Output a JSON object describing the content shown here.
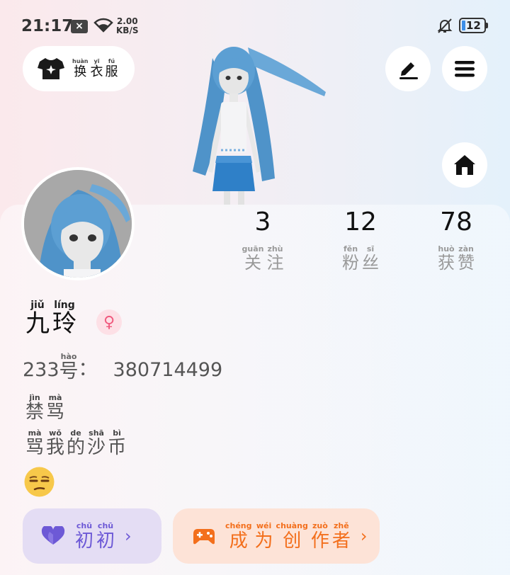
{
  "status_bar": {
    "time": "21:17",
    "close_icon": "x-box-icon",
    "net_speed_value": "2.00",
    "net_speed_unit": "KB/S",
    "battery": "12",
    "colors": {
      "battery_fill": "#3b8ee8"
    }
  },
  "toolbar": {
    "dress_up": {
      "icon": "shirt-icon",
      "chars": [
        {
          "py": "huàn",
          "hz": "换"
        },
        {
          "py": "yī",
          "hz": "衣"
        },
        {
          "py": "fú",
          "hz": "服"
        }
      ]
    },
    "edit_icon": "pencil-icon",
    "menu_icon": "hamburger-icon",
    "home_icon": "home-icon"
  },
  "profile": {
    "name": [
      {
        "py": "jiǔ",
        "hz": "九"
      },
      {
        "py": "líng",
        "hz": "玲"
      }
    ],
    "gender_icon": "♀",
    "uid_prefix": "233",
    "uid_char": {
      "py": "hào",
      "hz": "号"
    },
    "uid_sep": "：",
    "uid_value": "380714499",
    "bio_line1": [
      {
        "py": "jìn",
        "hz": "禁"
      },
      {
        "py": "mà",
        "hz": "骂"
      }
    ],
    "bio_line2": [
      {
        "py": "mà",
        "hz": "骂"
      },
      {
        "py": "wǒ",
        "hz": "我"
      },
      {
        "py": "de",
        "hz": "的"
      },
      {
        "py": "shā",
        "hz": "沙"
      },
      {
        "py": "bì",
        "hz": "币"
      }
    ],
    "emoji": "unamused-face"
  },
  "stats": [
    {
      "value": "3",
      "label": [
        {
          "py": "guān",
          "hz": "关"
        },
        {
          "py": "zhù",
          "hz": "注"
        }
      ]
    },
    {
      "value": "12",
      "label": [
        {
          "py": "fěn",
          "hz": "粉"
        },
        {
          "py": "sī",
          "hz": "丝"
        }
      ]
    },
    {
      "value": "78",
      "label": [
        {
          "py": "huò",
          "hz": "获"
        },
        {
          "py": "zàn",
          "hz": "赞"
        }
      ]
    }
  ],
  "actions": {
    "chuchu": {
      "icon": "heart-icon",
      "chars": [
        {
          "py": "chū",
          "hz": "初"
        },
        {
          "py": "chū",
          "hz": "初"
        }
      ],
      "arrow": "›",
      "color": "#6d59d6"
    },
    "creator": {
      "icon": "gamepad-icon",
      "chars": [
        {
          "py": "chéng",
          "hz": "成"
        },
        {
          "py": "wéi",
          "hz": "为"
        },
        {
          "py": "chuàng",
          "hz": "创"
        },
        {
          "py": "zuò",
          "hz": "作"
        },
        {
          "py": "zhě",
          "hz": "者"
        }
      ],
      "arrow": "›",
      "color": "#f36f1c"
    }
  }
}
